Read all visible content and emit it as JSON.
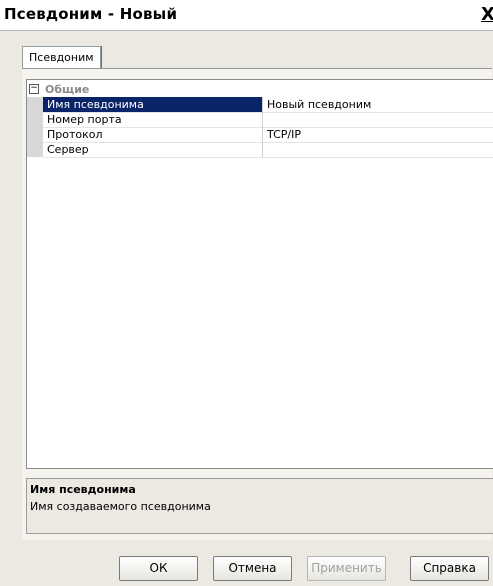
{
  "window": {
    "title": "Псевдоним - Новый",
    "close_label": "X"
  },
  "tabs": [
    {
      "label": "Псевдоним"
    }
  ],
  "grid": {
    "category": {
      "label": "Общие",
      "expander": "⊟"
    },
    "rows": [
      {
        "name": "Имя псевдонима",
        "value": "Новый псевдоним"
      },
      {
        "name": "Номер порта",
        "value": ""
      },
      {
        "name": "Протокол",
        "value": "TCP/IP"
      },
      {
        "name": "Сервер",
        "value": ""
      }
    ]
  },
  "description": {
    "title": "Имя псевдонима",
    "text": "Имя создаваемого псевдонима"
  },
  "buttons": {
    "ok": "ОК",
    "cancel": "Отмена",
    "apply": "Применить",
    "help": "Справка"
  }
}
